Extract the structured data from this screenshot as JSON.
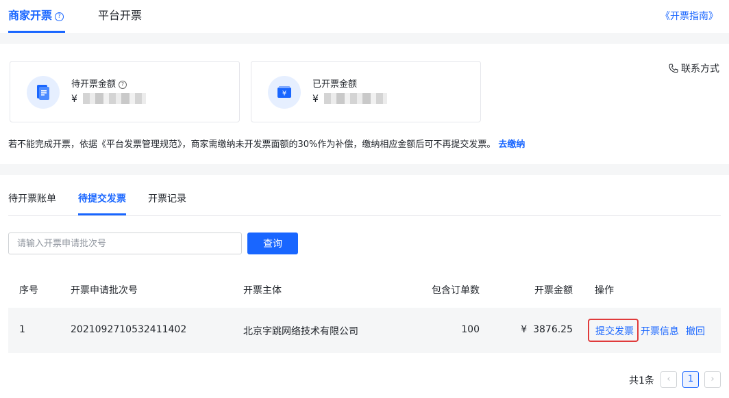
{
  "top_tabs": [
    {
      "label": "商家开票",
      "help": "?"
    },
    {
      "label": "平台开票"
    }
  ],
  "guide_link": "《开票指南》",
  "stats": [
    {
      "label": "待开票金额",
      "help": "?",
      "currency": "¥",
      "icon": "document-icon"
    },
    {
      "label": "已开票金额",
      "currency": "¥",
      "icon": "yen-card-icon"
    }
  ],
  "contact": "联系方式",
  "notice": {
    "text": "若不能完成开票，依据《平台发票管理规范》，商家需缴纳未开发票面额的30%作为补偿，缴纳相应金额后可不再提交发票。",
    "link": "去缴纳"
  },
  "sub_tabs": [
    {
      "label": "待开票账单"
    },
    {
      "label": "待提交发票"
    },
    {
      "label": "开票记录"
    }
  ],
  "search": {
    "placeholder": "请输入开票申请批次号",
    "button": "查询"
  },
  "table": {
    "headers": [
      "序号",
      "开票申请批次号",
      "开票主体",
      "包含订单数",
      "开票金额",
      "操作"
    ],
    "rows": [
      {
        "index": "1",
        "batch_no": "2021092710532411402",
        "entity": "北京字跳网络技术有限公司",
        "orders": "100",
        "amount": "¥  3876.25",
        "actions": [
          "提交发票",
          "开票信息",
          "撤回"
        ]
      }
    ]
  },
  "pagination": {
    "total": "共1条",
    "current": "1",
    "prev": "‹",
    "next": "›"
  },
  "colors": {
    "accent": "#1966ff",
    "highlight": "#e03b3b"
  }
}
